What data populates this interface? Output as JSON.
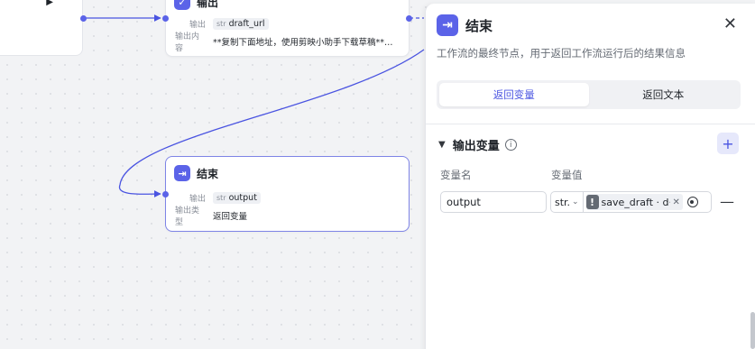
{
  "nodes": {
    "output_node": {
      "title": "输出",
      "output_label": "输出",
      "output_type": "str",
      "output_var": "draft_url",
      "content_label": "输出内容",
      "content_value": "**复制下面地址，使用剪映小助手下载草稿** *…"
    },
    "end_node": {
      "title": "结束",
      "output_label": "输出",
      "output_type": "str",
      "output_var": "output",
      "type_label": "输出类型",
      "type_value": "返回变量"
    }
  },
  "panel": {
    "title": "结束",
    "close_icon": "close-icon",
    "description": "工作流的最终节点，用于返回工作流运行后的结果信息",
    "tabs": [
      "返回变量",
      "返回文本"
    ],
    "active_tab": "返回变量",
    "section": {
      "title": "输出变量",
      "add_label": "+",
      "col_name": "变量名",
      "col_value": "变量值",
      "rows": [
        {
          "name": "output",
          "type": "str.",
          "ref": "save_draft · d·"
        }
      ]
    }
  },
  "colors": {
    "accent": "#5b63e8",
    "edge": "#4a54e1"
  }
}
